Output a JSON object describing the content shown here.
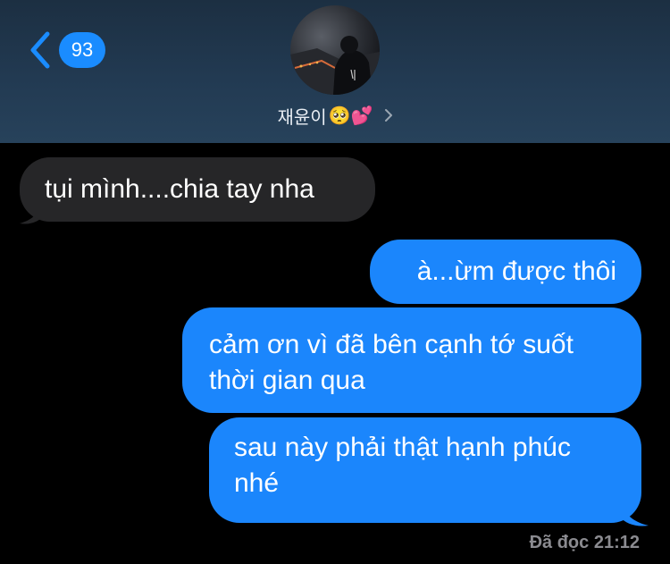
{
  "header": {
    "back_count": "93",
    "contact_name": "재윤이",
    "contact_emoji": [
      "🥺",
      "💕"
    ],
    "icons": {
      "back": "chevron-left-icon",
      "details": "chevron-right-icon"
    }
  },
  "messages": [
    {
      "direction": "incoming",
      "text": "tụi mình....chia tay nha"
    },
    {
      "direction": "outgoing",
      "text": "à...ừm được thôi"
    },
    {
      "direction": "outgoing",
      "lines": [
        "cảm ơn vì đã bên cạnh tớ suốt",
        "thời gian qua"
      ]
    },
    {
      "direction": "outgoing",
      "lines": [
        "sau này phải thật hạnh phúc",
        "nhé"
      ]
    }
  ],
  "read_receipt": {
    "label": "Đã đọc",
    "time": "21:12"
  },
  "colors": {
    "background": "#000000",
    "header": "#223a52",
    "outgoing_bubble": "#1b86fc",
    "incoming_bubble": "#262628",
    "badge": "#1a8cff"
  }
}
